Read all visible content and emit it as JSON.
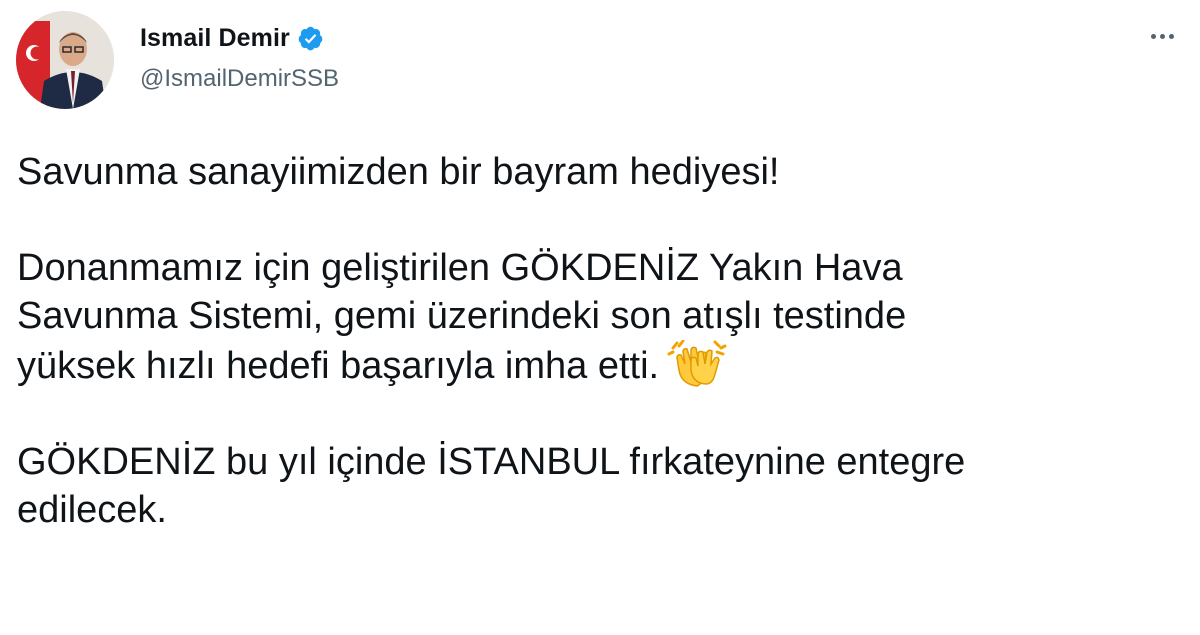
{
  "author": {
    "display_name": "Ismail Demir",
    "handle": "@IsmailDemirSSB",
    "verified_icon": "verified-badge-icon",
    "avatar_icon": "profile-photo"
  },
  "menu": {
    "more_icon": "more-options-icon"
  },
  "tweet": {
    "paragraph1": {
      "line1": "Savunma sanayiimizden bir bayram hediyesi!"
    },
    "paragraph2": {
      "line1": "Donanmamız için geliştirilen GÖKDENİZ Yakın Hava",
      "line2": "Savunma Sistemi, gemi üzerindeki son atışlı testinde",
      "line3": "yüksek hızlı hedefi başarıyla imha etti.",
      "emoji": "clapping-hands-icon"
    },
    "paragraph3": {
      "line1": "GÖKDENİZ bu yıl içinde İSTANBUL fırkateynine entegre",
      "line2": "edilecek."
    }
  },
  "colors": {
    "text": "#0f1419",
    "secondary": "#536471",
    "verified": "#1d9bf0"
  }
}
